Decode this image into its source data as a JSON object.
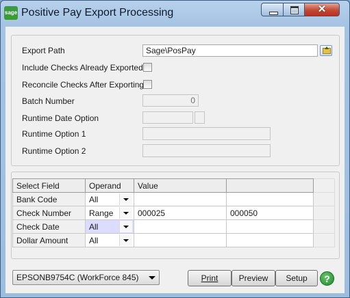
{
  "window": {
    "title": "Positive Pay Export Processing",
    "app_icon_text": "sage",
    "controls": {
      "minimize": "minimize-icon",
      "maximize": "maximize-icon",
      "close_glyph": "✕"
    }
  },
  "form": {
    "export_path_label": "Export Path",
    "export_path_value": "Sage\\PosPay",
    "include_checks_label": "Include Checks Already Exported",
    "reconcile_checks_label": "Reconcile Checks After Exporting",
    "batch_number_label": "Batch Number",
    "batch_number_value": "0",
    "runtime_date_label": "Runtime Date Option",
    "runtime_option1_label": "Runtime Option 1",
    "runtime_option2_label": "Runtime Option 2"
  },
  "grid": {
    "headers": [
      "Select Field",
      "Operand",
      "Value",
      ""
    ],
    "rows": [
      {
        "field": "Bank Code",
        "operand": "All",
        "value": "",
        "value2": ""
      },
      {
        "field": "Check Number",
        "operand": "Range",
        "value": "000025",
        "value2": "000050"
      },
      {
        "field": "Check Date",
        "operand": "All",
        "value": "",
        "value2": ""
      },
      {
        "field": "Dollar Amount",
        "operand": "All",
        "value": "",
        "value2": ""
      }
    ]
  },
  "footer": {
    "printer": "EPSONB9754C (WorkForce 845)",
    "print_label": "Print",
    "preview_label": "Preview",
    "setup_label": "Setup",
    "help_label": "?"
  },
  "colors": {
    "selected_cell": "#dcdcff",
    "help_button": "#2b9a36",
    "titlebar": "#a5c3e3"
  }
}
